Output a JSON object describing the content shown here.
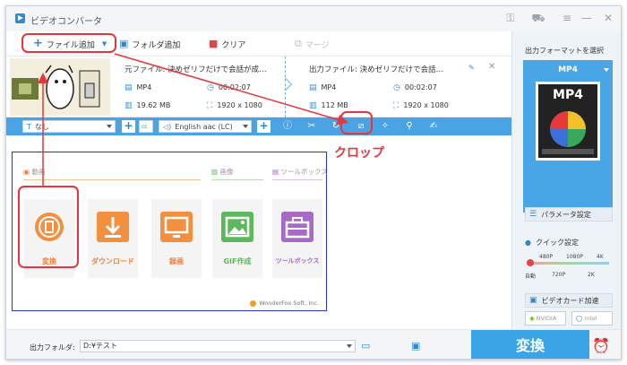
{
  "window": {
    "title": "ビデオコンバータ"
  },
  "toolbar": {
    "add_file": "ファイル追加",
    "add_folder": "フォルダ追加",
    "clear": "クリア",
    "merge": "マージ"
  },
  "source": {
    "title": "元ファイル: 決めゼリフだけで会話が成…",
    "format": "MP4",
    "duration": "00:02:07",
    "size": "19.62 MB",
    "resolution": "1920 x 1080"
  },
  "output": {
    "title": "出力ファイル: 決めゼリフだけで会話…",
    "format": "MP4",
    "duration": "00:02:07",
    "size": "112 MB",
    "resolution": "1920 x 1080"
  },
  "editbar": {
    "subtitle_value": "なし",
    "audio_value": "English aac (LC)"
  },
  "annotation": {
    "crop_callout": "クロップ"
  },
  "sections": {
    "video": "動画",
    "image": "画像",
    "toolbox": "ツールボックス"
  },
  "cards": {
    "convert": "変換",
    "download": "ダウンロード",
    "record": "録画",
    "gif": "GIF作成",
    "toolbox": "ツールボックス"
  },
  "watermark": "WonderFox Soft, Inc.",
  "bottom": {
    "output_folder_label": "出力フォルダ:",
    "output_folder_value": "D:¥テスト",
    "convert_button": "変換"
  },
  "right_panel": {
    "title": "出力フォーマットを選択",
    "format": "MP4",
    "icon_text": "MP4",
    "param_settings": "パラメータ設定",
    "quick_settings": "クイック設定",
    "quick_top": [
      "480P",
      "1080P",
      "4K"
    ],
    "quick_bottom": [
      "自動",
      "720P",
      "2K"
    ],
    "quick_value": "自動",
    "gpu_title": "ビデオカード加速",
    "gpu_nvidia": "NVIDIA",
    "gpu_intel": "Intel"
  },
  "colors": {
    "accent": "#3aa5e6",
    "annotation_red": "#e8343a",
    "section_box": "#2430c8"
  }
}
